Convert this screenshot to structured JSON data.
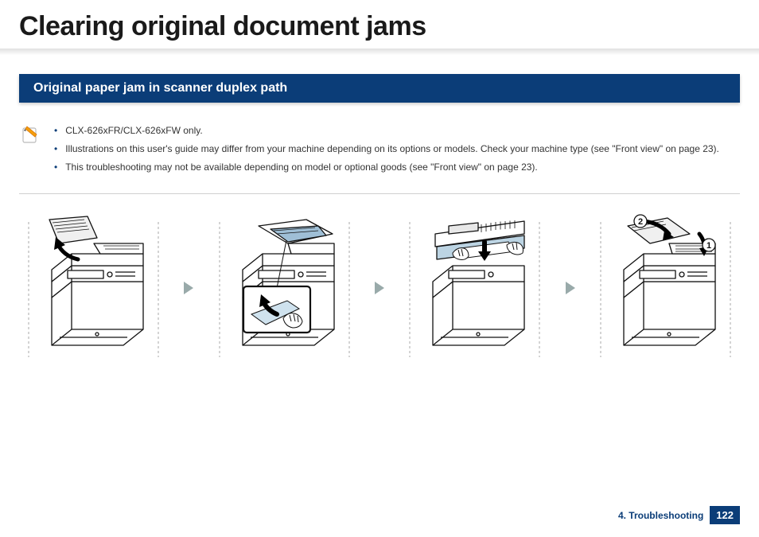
{
  "title": "Clearing original document jams",
  "section_heading": "Original paper jam in scanner duplex path",
  "notes": {
    "bullets": [
      "CLX-626xFR/CLX-626xFW only.",
      "Illustrations on this user's guide may differ from your machine depending on its options or models. Check your machine type (see \"Front view\" on page 23).",
      "This troubleshooting may not be available depending on model or optional goods (see \"Front view\" on page 23)."
    ]
  },
  "steps": {
    "count": 4,
    "labels": {
      "step4_badge_1": "1",
      "step4_badge_2": "2"
    }
  },
  "footer": {
    "chapter": "4. Troubleshooting",
    "page": "122"
  },
  "colors": {
    "primary": "#0b3d78",
    "accent_orange": "#f59e0b"
  }
}
